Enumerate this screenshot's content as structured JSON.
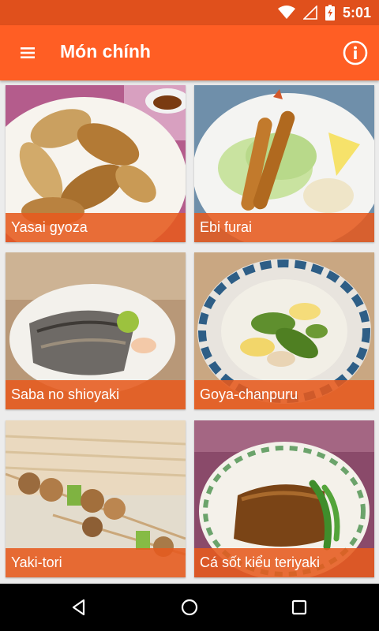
{
  "status_bar": {
    "time": "5:01",
    "icons": [
      "wifi-icon",
      "cell-signal-icon",
      "battery-charging-icon"
    ]
  },
  "app_bar": {
    "title": "Món chính",
    "menu_icon": "hamburger-menu-icon",
    "info_icon": "info-icon"
  },
  "dishes": [
    {
      "label": "Yasai gyoza"
    },
    {
      "label": "Ebi furai"
    },
    {
      "label": "Saba no shioyaki"
    },
    {
      "label": "Goya-chanpuru"
    },
    {
      "label": "Yaki-tori"
    },
    {
      "label": "Cá sốt kiểu teriyaki"
    }
  ],
  "nav_bar": {
    "icons": [
      "back-icon",
      "home-icon",
      "recents-icon"
    ]
  },
  "colors": {
    "status_bar": "#e0501c",
    "app_bar": "#ff5e24",
    "caption": "#e65a1e",
    "background": "#ececec"
  }
}
